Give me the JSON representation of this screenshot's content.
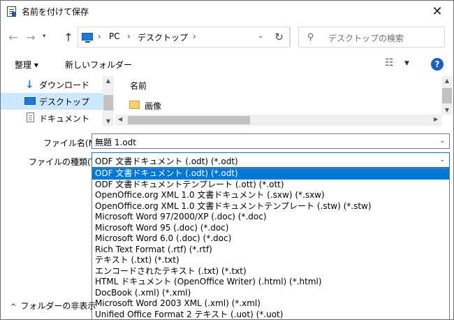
{
  "window": {
    "title": "名前を付けて保存"
  },
  "nav": {
    "breadcrumb": [
      "PC",
      "デスクトップ"
    ],
    "search_placeholder": "デスクトップの検索"
  },
  "toolbar": {
    "organize": "整理 ▾",
    "new_folder": "新しいフォルダー",
    "help": "?"
  },
  "sidebar": {
    "items": [
      {
        "label": "ダウンロード",
        "icon": "download-icon"
      },
      {
        "label": "デスクトップ",
        "icon": "desktop-icon",
        "selected": true
      },
      {
        "label": "ドキュメント",
        "icon": "document-icon"
      }
    ]
  },
  "files": {
    "column_name": "名前",
    "items": [
      {
        "label": "画像",
        "icon": "folder-icon"
      }
    ]
  },
  "form": {
    "filename_label": "ファイル名(N):",
    "filename_value": "無題 1.odt",
    "filetype_label": "ファイルの種類(T):",
    "filetype_value": "ODF 文書ドキュメント (.odt) (*.odt)"
  },
  "filetype_options": [
    "ODF 文書ドキュメント (.odt) (*.odt)",
    "ODF 文書ドキュメントテンプレート (.ott) (*.ott)",
    "OpenOffice.org XML 1.0 文書ドキュメント (.sxw) (*.sxw)",
    "OpenOffice.org XML 1.0 文書ドキュメントテンプレート (.stw) (*.stw)",
    "Microsoft Word 97/2000/XP (.doc) (*.doc)",
    "Microsoft Word 95 (.doc) (*.doc)",
    "Microsoft Word 6.0 (.doc) (*.doc)",
    "Rich Text Format (.rtf) (*.rtf)",
    "テキスト (.txt) (*.txt)",
    "エンコードされたテキスト (.txt) (*.txt)",
    "HTML ドキュメント (OpenOffice Writer) (.html) (*.html)",
    "DocBook (.xml) (*.xml)",
    "Microsoft Word 2003 XML (.xml) (*.xml)",
    "Unified Office Format 2 テキスト (.uot) (*.uot)"
  ],
  "selected_option_index": 0,
  "footer": {
    "hide_folders": "フォルダーの非表示"
  }
}
